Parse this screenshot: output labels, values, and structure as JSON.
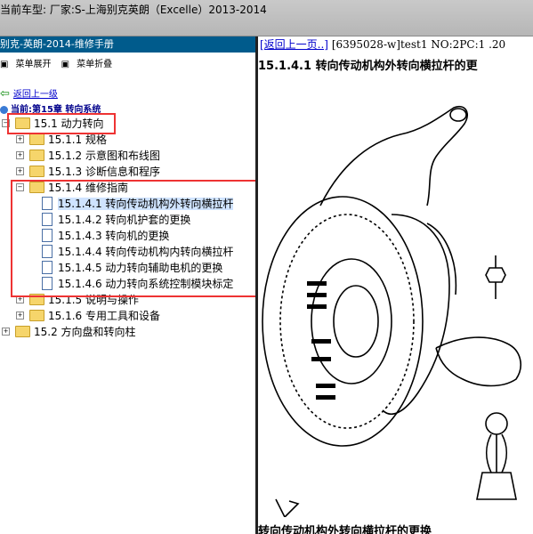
{
  "window": {
    "title": "当前车型:  厂家:S-上海别克英朗（Excelle）2013-2014"
  },
  "left_panel": {
    "title": "别克-英朗-2014-维修手册",
    "menu": {
      "expand": "菜单展开",
      "collapse": "菜单折叠"
    },
    "back_link": "返回上一级",
    "current_chapter": "当前:第15章 转向系统"
  },
  "tree": [
    {
      "label": "15.1 动力转向",
      "level": 0,
      "expander": "−",
      "kind": "folder"
    },
    {
      "label": "15.1.1 规格",
      "level": 1,
      "expander": "+",
      "kind": "folder"
    },
    {
      "label": "15.1.2 示意图和布线图",
      "level": 1,
      "expander": "+",
      "kind": "folder"
    },
    {
      "label": "15.1.3 诊断信息和程序",
      "level": 1,
      "expander": "+",
      "kind": "folder"
    },
    {
      "label": "15.1.4 维修指南",
      "level": 1,
      "expander": "−",
      "kind": "folder"
    },
    {
      "label": "15.1.4.1 转向传动机构外转向横拉杆",
      "level": 2,
      "expander": "",
      "kind": "doc",
      "selected": true
    },
    {
      "label": "15.1.4.2 转向机护套的更换",
      "level": 2,
      "expander": "",
      "kind": "doc"
    },
    {
      "label": "15.1.4.3 转向机的更换",
      "level": 2,
      "expander": "",
      "kind": "doc"
    },
    {
      "label": "15.1.4.4 转向传动机构内转向横拉杆",
      "level": 2,
      "expander": "",
      "kind": "doc"
    },
    {
      "label": "15.1.4.5 动力转向辅助电机的更换",
      "level": 2,
      "expander": "",
      "kind": "doc"
    },
    {
      "label": "15.1.4.6 动力转向系统控制模块标定",
      "level": 2,
      "expander": "",
      "kind": "doc"
    },
    {
      "label": "15.1.5 说明与操作",
      "level": 1,
      "expander": "+",
      "kind": "folder"
    },
    {
      "label": "15.1.6 专用工具和设备",
      "level": 1,
      "expander": "+",
      "kind": "folder"
    },
    {
      "label": "15.2 方向盘和转向柱",
      "level": 0,
      "expander": "+",
      "kind": "folder"
    }
  ],
  "right_panel": {
    "nav_link": "[返回上一页..]",
    "nav_info": " [6395028-w]test1 NO:2PC:1 .20",
    "heading": "15.1.4.1 转向传动机构外转向横拉杆的更",
    "caption": "转向传动机构外转向横拉杆的更换"
  },
  "colors": {
    "accent": "#005b8c",
    "highlight_box": "#e33333",
    "selection": "#cfe3ff",
    "link": "#0000cc"
  }
}
